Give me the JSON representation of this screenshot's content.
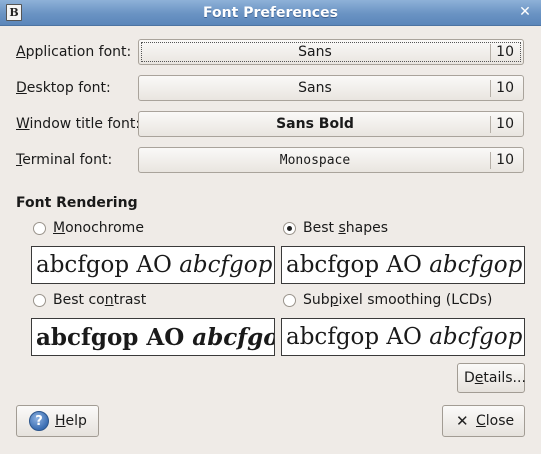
{
  "window": {
    "title": "Font Preferences",
    "app_icon_glyph": "B"
  },
  "fonts": [
    {
      "label_first": "A",
      "label_rest": "pplication font:",
      "name": "Sans",
      "size": "10",
      "style": "normal"
    },
    {
      "label_first": "D",
      "label_rest": "esktop font:",
      "name": "Sans",
      "size": "10",
      "style": "normal"
    },
    {
      "label_first": "W",
      "label_rest": "indow title font:",
      "name": "Sans Bold",
      "size": "10",
      "style": "bold"
    },
    {
      "label_first": "T",
      "label_rest": "erminal font:",
      "name": "Monospace",
      "size": "10",
      "style": "mono"
    }
  ],
  "rendering": {
    "title": "Font Rendering",
    "options": [
      {
        "pre": "",
        "mn": "M",
        "post": "onochrome",
        "checked": false
      },
      {
        "pre": "Best ",
        "mn": "s",
        "post": "hapes",
        "checked": true
      },
      {
        "pre": "Best co",
        "mn": "n",
        "post": "trast",
        "checked": false
      },
      {
        "pre": "Sub",
        "mn": "p",
        "post": "ixel smoothing (LCDs)",
        "checked": false
      }
    ],
    "sample_plain": "abcfgop AO ",
    "sample_italic": "abcfgop"
  },
  "buttons": {
    "details_pre": "D",
    "details_mn": "e",
    "details_post": "tails...",
    "help_mn": "H",
    "help_post": "elp",
    "close_mn": "C",
    "close_post": "lose"
  },
  "icons": {
    "help": "help-icon",
    "close": "close-icon",
    "window_close": "window-close-icon"
  }
}
